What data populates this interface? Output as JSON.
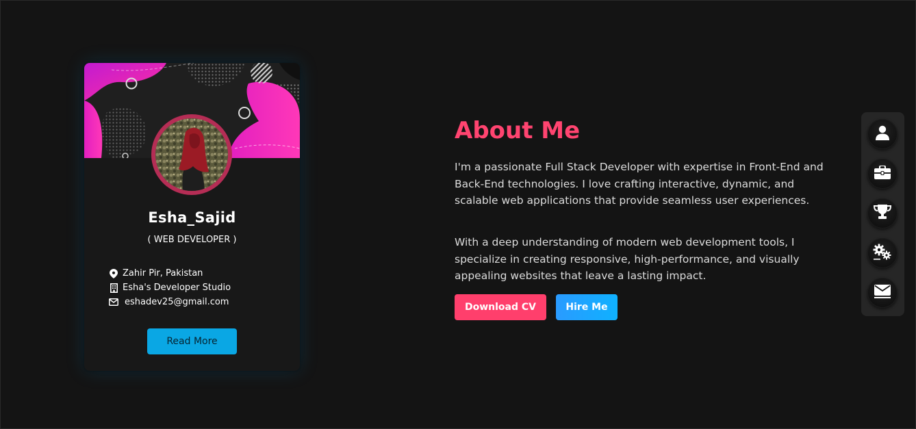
{
  "profile": {
    "name": "Esha_Sajid",
    "role": "( WEB DEVELOPER )",
    "location": "Zahir Pir, Pakistan",
    "company": "Esha's Developer Studio",
    "email": "eshadev25@gmail.com",
    "read_more_label": "Read More"
  },
  "about": {
    "title": "About Me",
    "paragraph1": "I'm a passionate Full Stack Developer with expertise in Front-End and Back-End technologies. I love crafting interactive, dynamic, and scalable web applications that provide seamless user experiences.",
    "paragraph2": "With a deep understanding of modern web development tools, I specialize in creating responsive, high-performance, and visually appealing websites that leave a lasting impact.",
    "download_cv_label": "Download CV",
    "hire_me_label": "Hire Me"
  },
  "sidenav": {
    "items": [
      {
        "icon": "user-icon"
      },
      {
        "icon": "briefcase-icon"
      },
      {
        "icon": "trophy-icon"
      },
      {
        "icon": "gears-icon"
      },
      {
        "icon": "envelope-icon"
      }
    ]
  },
  "colors": {
    "background": "#141414",
    "card": "#181818",
    "accent_pink": "#ff4470",
    "accent_blue": "#0aa7e4",
    "avatar_ring": "#b52d55"
  }
}
